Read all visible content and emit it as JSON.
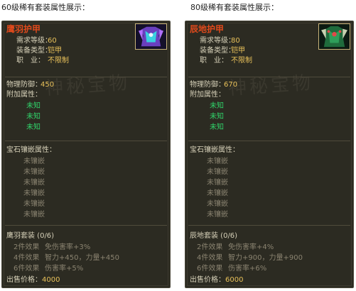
{
  "left": {
    "caption": "60级稀有套装属性展示：",
    "name": "鹰羽护甲",
    "req_label": "需求等级：",
    "req_value": "60",
    "type_label": "装备类型：",
    "type_value": "铠甲",
    "job_label": "职　业：",
    "job_value": "不限制",
    "def_label": "物理防御：",
    "def_value": "450",
    "extra_label": "附加属性：",
    "unknowns": [
      "未知",
      "未知",
      "未知"
    ],
    "gem_label": "宝石镶嵌属性：",
    "gems": [
      "未镶嵌",
      "未镶嵌",
      "未镶嵌",
      "未镶嵌",
      "未镶嵌",
      "未镶嵌"
    ],
    "set_title": "鹰羽套装 (0/6)",
    "set_rows": [
      {
        "label": "2件效果",
        "value": "免伤害率+3%"
      },
      {
        "label": "4件效果",
        "value": "智力+450，力量+450"
      },
      {
        "label": "6件效果",
        "value": "伤害率+5%"
      }
    ],
    "price_label": "出售价格：",
    "price_value": "4000",
    "icon_name": "purple-armor-icon"
  },
  "right": {
    "caption": "80级稀有套装属性展示：",
    "name": "辰地护甲",
    "req_label": "需求等级：",
    "req_value": "80",
    "type_label": "装备类型：",
    "type_value": "铠甲",
    "job_label": "职　业：",
    "job_value": "不限制",
    "def_label": "物理防御：",
    "def_value": "670",
    "extra_label": "附加属性：",
    "unknowns": [
      "未知",
      "未知",
      "未知"
    ],
    "gem_label": "宝石镶嵌属性：",
    "gems": [
      "未镶嵌",
      "未镶嵌",
      "未镶嵌",
      "未镶嵌",
      "未镶嵌",
      "未镶嵌"
    ],
    "set_title": "辰地套装 (0/6)",
    "set_rows": [
      {
        "label": "2件效果",
        "value": "免伤害率+4%"
      },
      {
        "label": "4件效果",
        "value": "智力+900，力量+900"
      },
      {
        "label": "6件效果",
        "value": "伤害率+6%"
      }
    ],
    "price_label": "出售价格：",
    "price_value": "6000",
    "icon_name": "green-armor-icon"
  },
  "watermark": "神秘宝物",
  "colors": {
    "panel_bg": "#2c2b22",
    "title_red": "#e14a1c",
    "value_gold": "#e8c15a",
    "unknown_green": "#30d46a",
    "label_gray": "#d6d0b8",
    "dim_gray": "#8a8370"
  }
}
